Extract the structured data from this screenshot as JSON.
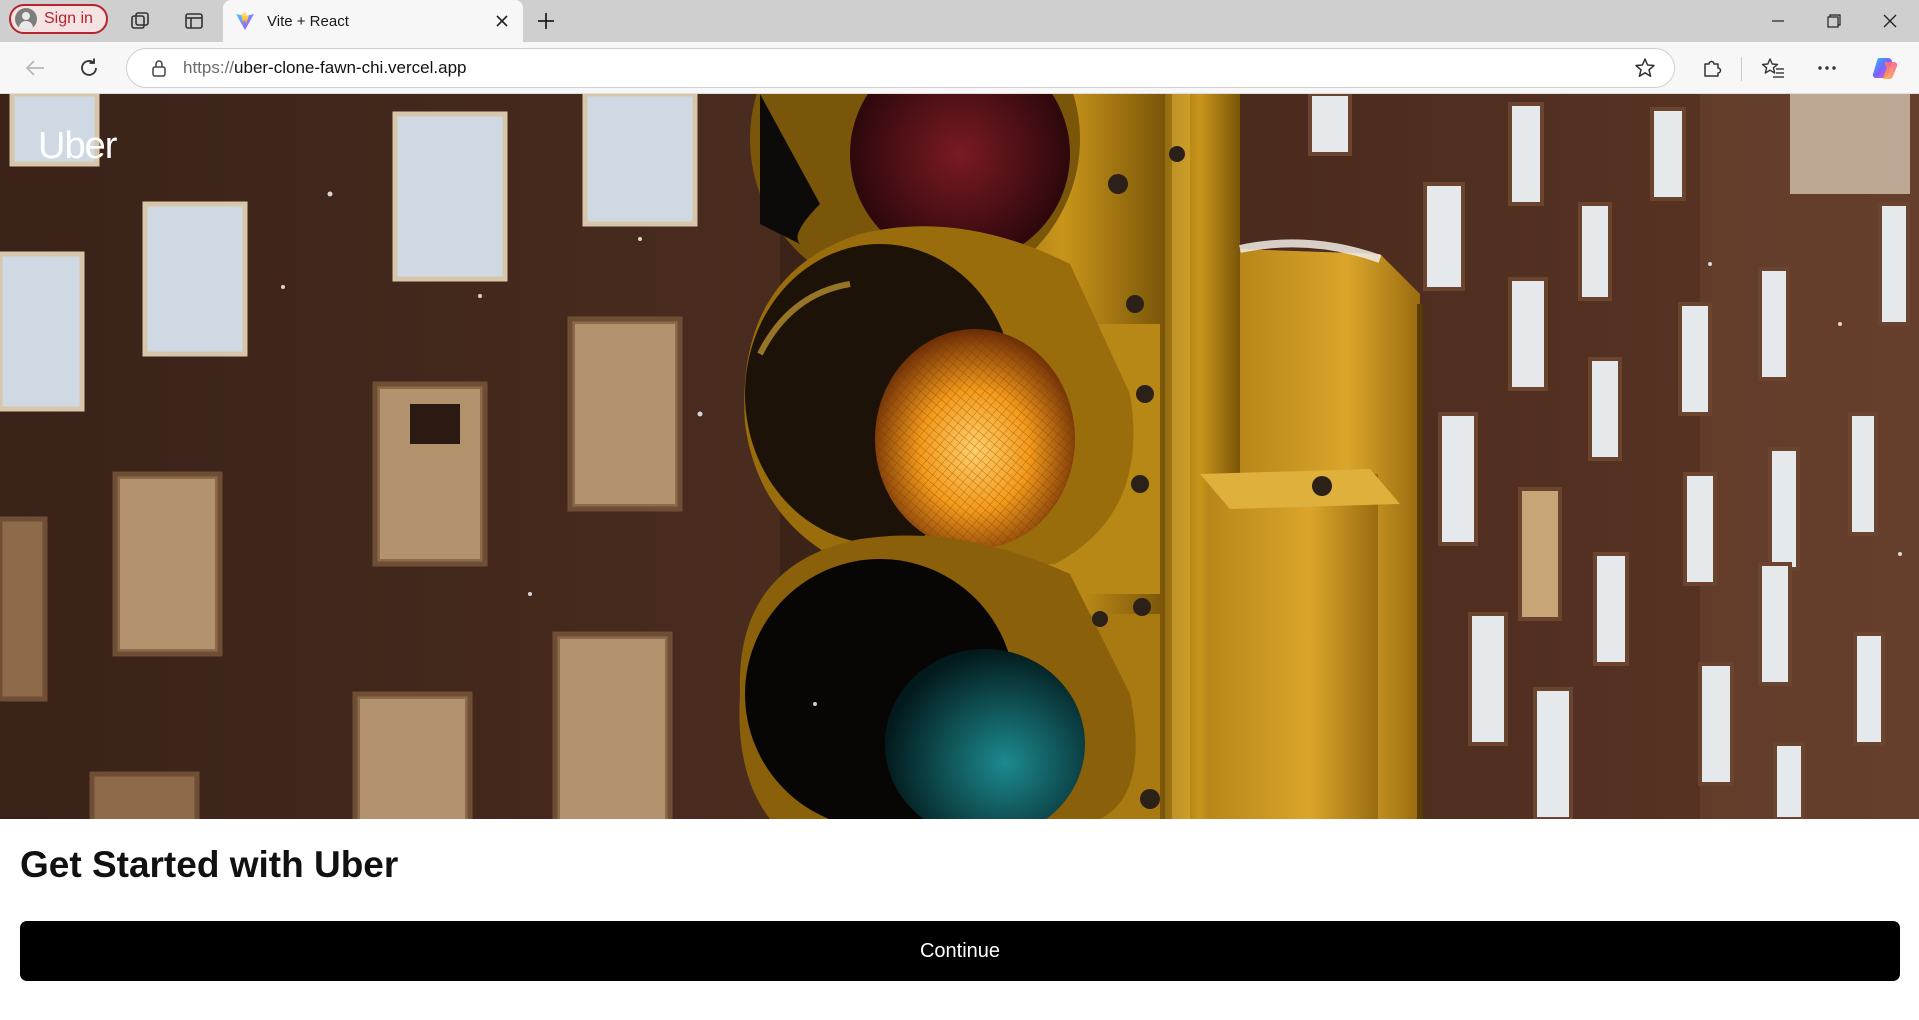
{
  "browser": {
    "profile": {
      "signin_label": "Sign in"
    },
    "tab": {
      "title": "Vite + React"
    },
    "address": {
      "scheme": "https://",
      "host": "uber-clone-fawn-chi.vercel.app"
    },
    "icons": {
      "workspaces": "workspaces-icon",
      "tab_actions": "tab-actions-icon",
      "favicon": "vite-favicon-icon",
      "close_tab": "close-icon",
      "new_tab": "plus-icon",
      "minimize": "minimize-icon",
      "restore": "restore-icon",
      "close_window": "close-window-icon",
      "back": "back-arrow-icon",
      "reload": "reload-icon",
      "lock": "lock-icon",
      "favorite": "star-icon",
      "extensions": "puzzle-icon",
      "favorites": "favorites-list-icon",
      "menu": "ellipsis-icon",
      "copilot": "copilot-icon"
    }
  },
  "page": {
    "brand": "Uber",
    "heading": "Get Started with Uber",
    "continue_label": "Continue",
    "hero_image": "traffic-light-photo"
  },
  "colors": {
    "signin_accent": "#b3262e",
    "button_bg": "#000000",
    "button_text": "#ffffff",
    "heading_text": "#111111"
  }
}
